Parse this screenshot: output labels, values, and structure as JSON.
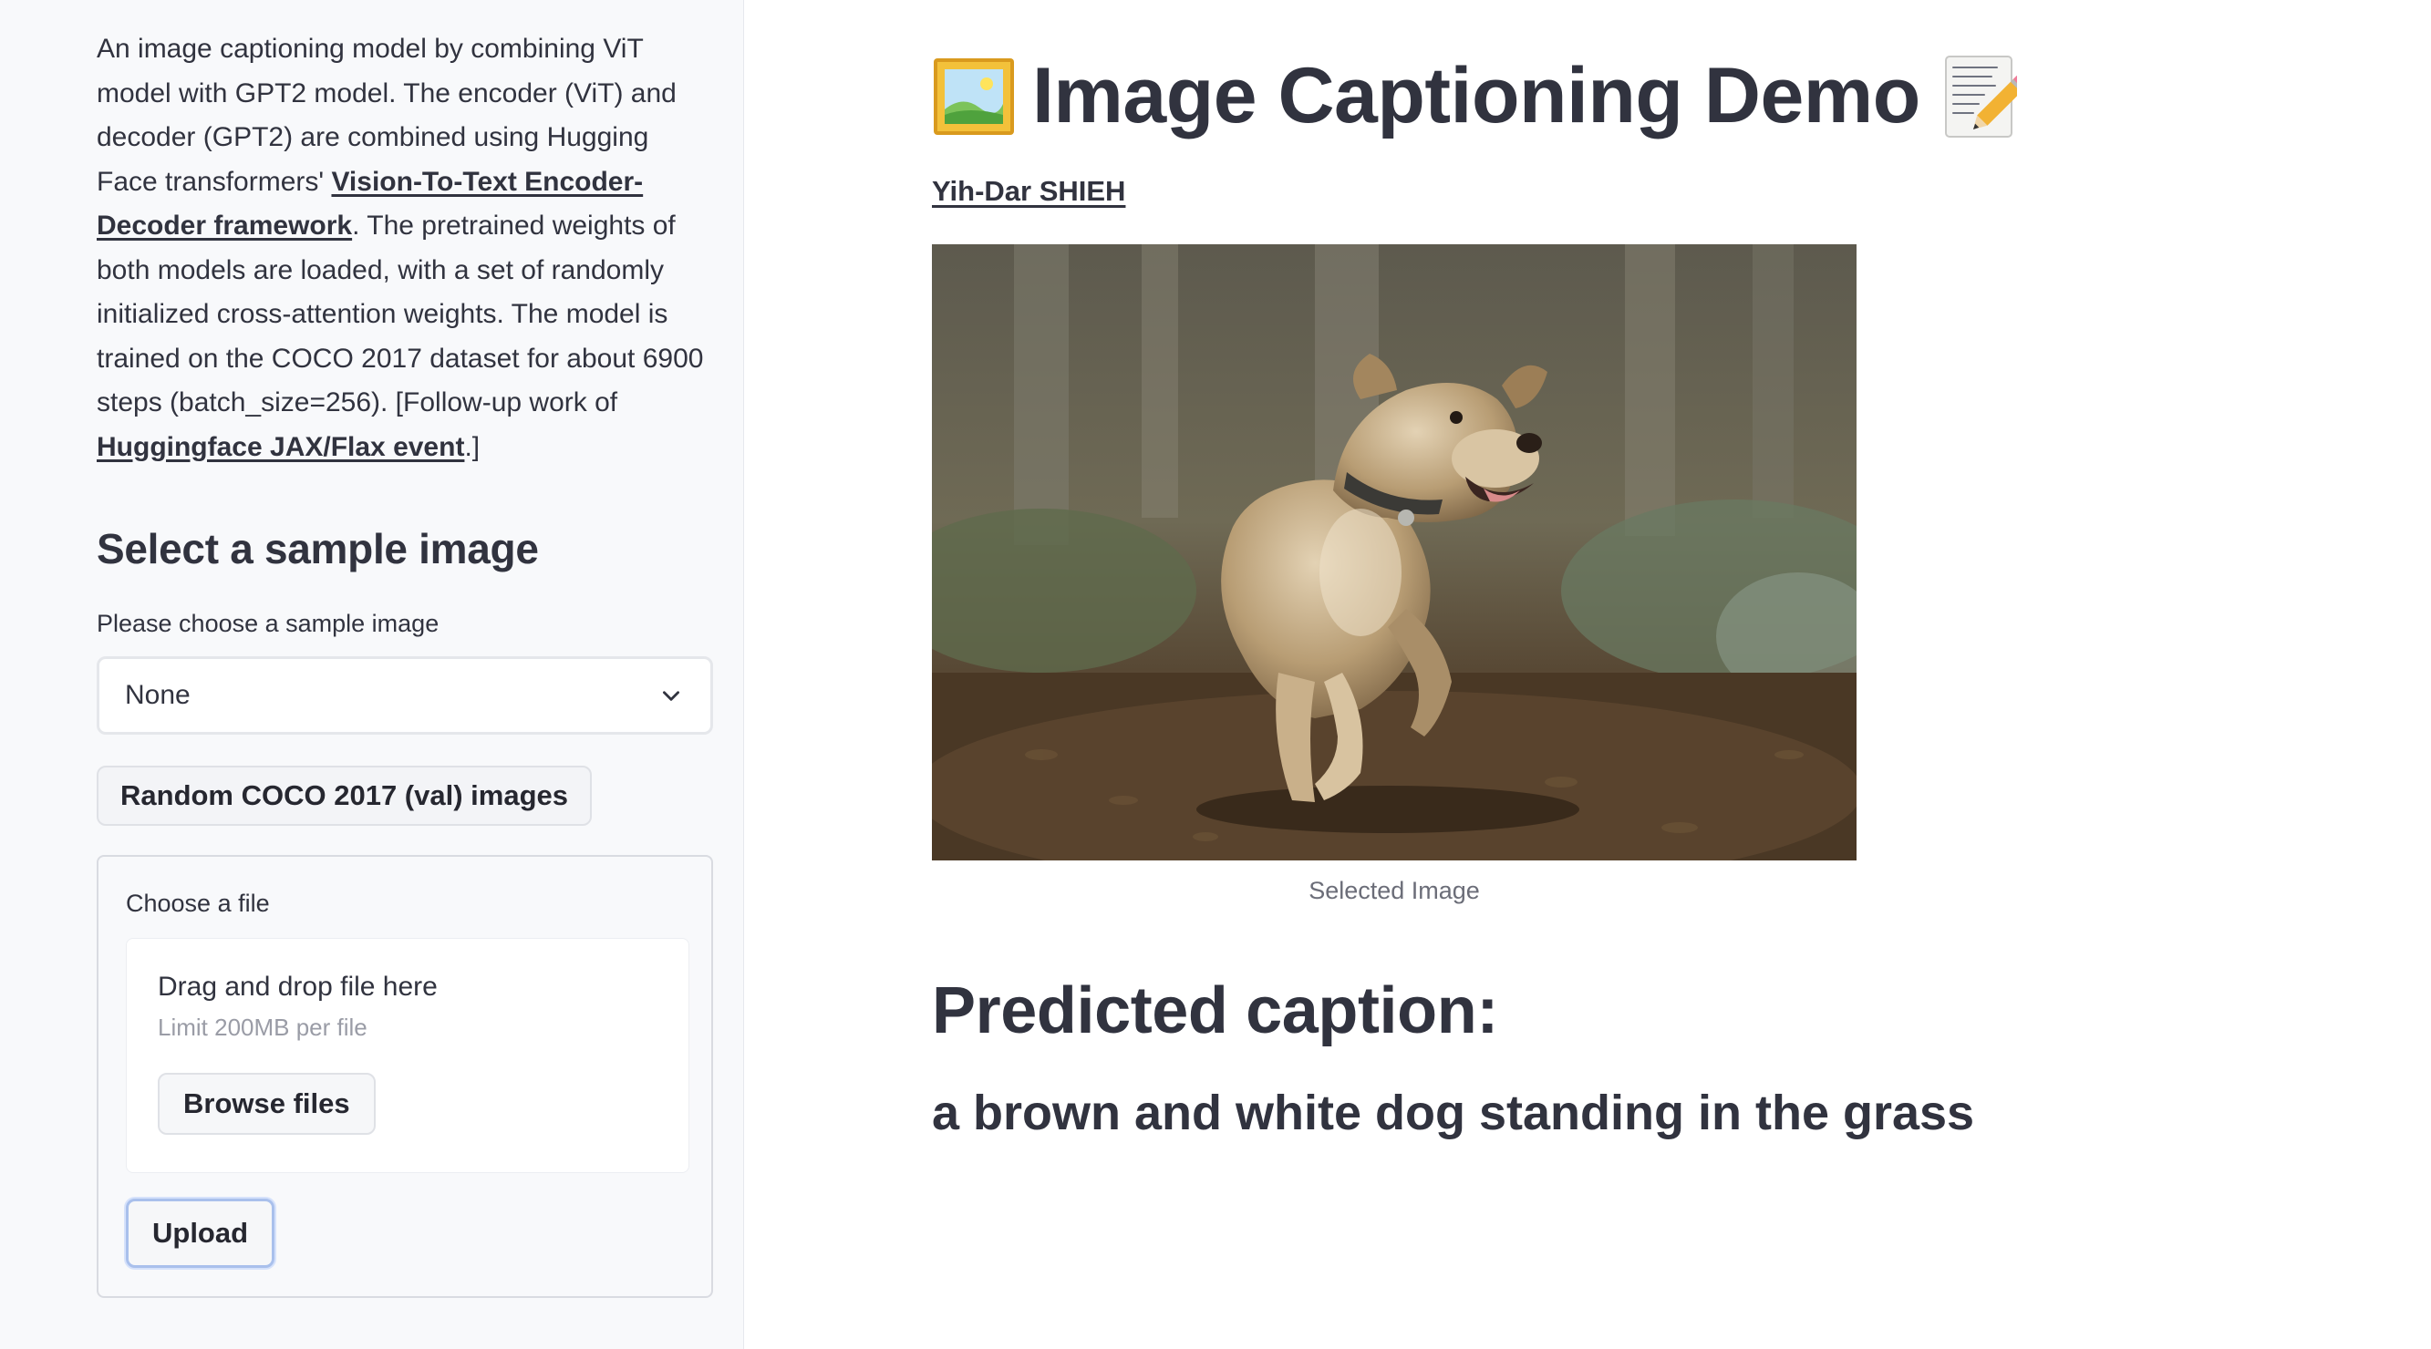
{
  "sidebar": {
    "description_parts": {
      "intro": "An image captioning model by combining ViT model with GPT2 model. The encoder (ViT) and decoder (GPT2) are combined using Hugging Face transformers' ",
      "link1": "Vision-To-Text Encoder-Decoder framework",
      "middle": ". The pretrained weights of both models are loaded, with a set of randomly initialized cross-attention weights. The model is trained on the COCO 2017 dataset for about 6900 steps (batch_size=256). [Follow-up work of ",
      "link2": "Huggingface JAX/Flax event",
      "end": ".]"
    },
    "section_heading": "Select a sample image",
    "select_label": "Please choose a sample image",
    "select_value": "None",
    "random_button": "Random COCO 2017 (val) images",
    "upload_form": {
      "label": "Choose a file",
      "dropzone_title": "Drag and drop file here",
      "dropzone_limit": "Limit 200MB per file",
      "browse_button": "Browse files",
      "upload_button": "Upload"
    }
  },
  "main": {
    "title": "Image Captioning Demo",
    "title_icons": [
      "framed-picture-icon",
      "memo-icon"
    ],
    "author": "Yih-Dar SHIEH",
    "image_caption": "Selected Image",
    "predicted_heading": "Predicted caption:",
    "predicted_text": "a brown and white dog standing in the grass"
  },
  "colors": {
    "text": "#31333f",
    "sidebar_bg": "#f8f9fb",
    "muted": "#9a9ca6",
    "focus_ring": "#a9c0ec"
  }
}
